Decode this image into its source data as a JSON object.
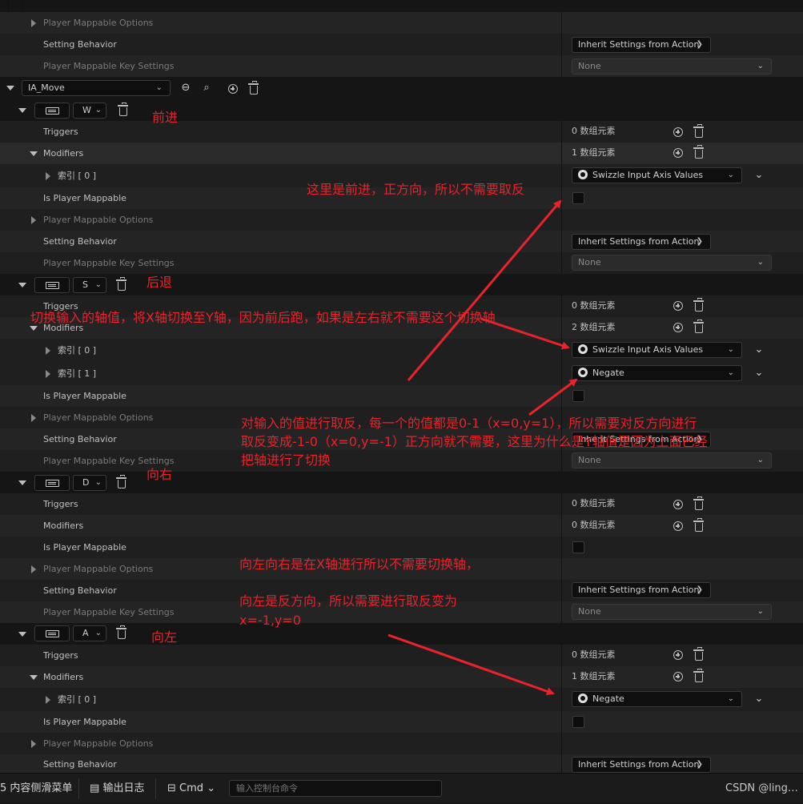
{
  "details": {
    "top_rows": {
      "player_mappable_options": "Player Mappable Options",
      "setting_behavior": "Setting Behavior",
      "setting_behavior_value": "Inherit Settings from Action",
      "player_mappable_key_settings": "Player Mappable Key Settings",
      "key_settings_value": "None"
    },
    "mapping": {
      "action": "IA_Move"
    },
    "labels": {
      "triggers": "Triggers",
      "modifiers": "Modifiers",
      "index0": "索引 [ 0 ]",
      "index1": "索引 [ 1 ]",
      "is_player_mappable": "Is Player Mappable",
      "player_mappable_options": "Player Mappable Options",
      "setting_behavior": "Setting Behavior",
      "player_mappable_key_settings": "Player Mappable Key Settings"
    },
    "values": {
      "inherit": "Inherit Settings from Action",
      "none": "None",
      "swizzle": "Swizzle Input Axis Values",
      "negate": "Negate"
    },
    "keys": {
      "w": {
        "key": "W",
        "triggers_count": "0 数组元素",
        "modifiers_count": "1 数组元素"
      },
      "s": {
        "key": "S",
        "triggers_count": "0 数组元素",
        "modifiers_count": "2 数组元素"
      },
      "d": {
        "key": "D",
        "triggers_count": "0 数组元素",
        "modifiers_count": "0 数组元素"
      },
      "a": {
        "key": "A",
        "triggers_count": "0 数组元素",
        "modifiers_count": "1 数组元素"
      }
    }
  },
  "annotations": {
    "forward": "前进",
    "backward": "后退",
    "right": "向右",
    "left": "向左",
    "note_forward": "这里是前进，正方向，所以不需要取反",
    "note_swizzle": "切换输入的轴值，将X轴切换至Y轴，因为前后跑，如果是左右就不需要这个切换轴",
    "note_negate_line1": "对输入的值进行取反，每一个的值都是0-1（x=0,y=1），所以需要对反方向进行",
    "note_negate_line2": "取反变成-1-0（x=0,y=-1）正方向就不需要，这里为什么是Y轴值是因为上面已经",
    "note_negate_line3": "把轴进行了切换",
    "note_lr_line1": "向左向右是在X轴进行所以不需要切换轴，",
    "note_lr_line2": "向左是反方向，所以需要进行取反变为",
    "note_lr_line3": "x=-1,y=0",
    "arrow_color": "#e8232a"
  },
  "bottombar": {
    "content_drawer": "内容侧滑菜单",
    "content_drawer_prefix": "5",
    "output_log": "输出日志",
    "cmd": "Cmd",
    "console_placeholder": "输入控制台命令",
    "watermark": "CSDN @ling…"
  }
}
